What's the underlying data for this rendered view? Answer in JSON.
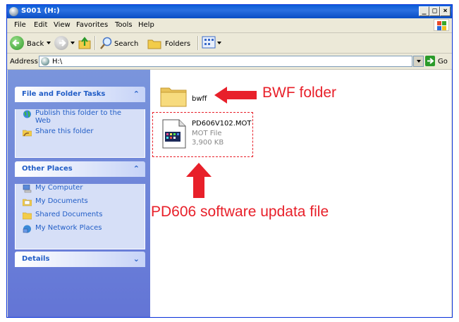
{
  "window": {
    "title": "S001 (H:)"
  },
  "menu": {
    "items": [
      "File",
      "Edit",
      "View",
      "Favorites",
      "Tools",
      "Help"
    ]
  },
  "toolbar": {
    "back_label": "Back",
    "search_label": "Search",
    "folders_label": "Folders"
  },
  "address": {
    "label": "Address",
    "value": "H:\\",
    "go_label": "Go"
  },
  "tasks_panel": {
    "title": "File and Folder Tasks",
    "items": [
      {
        "label": "Publish this folder to the Web",
        "icon": "globe-icon"
      },
      {
        "label": "Share this folder",
        "icon": "share-folder-icon"
      }
    ]
  },
  "places_panel": {
    "title": "Other Places",
    "items": [
      {
        "label": "My Computer",
        "icon": "computer-icon"
      },
      {
        "label": "My Documents",
        "icon": "folder-icon"
      },
      {
        "label": "Shared Documents",
        "icon": "folder-icon"
      },
      {
        "label": "My Network Places",
        "icon": "network-icon"
      }
    ]
  },
  "details_panel": {
    "title": "Details"
  },
  "files": [
    {
      "name": "bwff",
      "type": "folder"
    },
    {
      "name": "PD606V102.MOT",
      "type": "MOT File",
      "size": "3,900 KB"
    }
  ],
  "annotations": {
    "folder_callout": "BWF folder",
    "file_callout": "PD606 software updata file"
  },
  "colors": {
    "annotation": "#e8202a",
    "pane_header_text": "#215dc6"
  }
}
